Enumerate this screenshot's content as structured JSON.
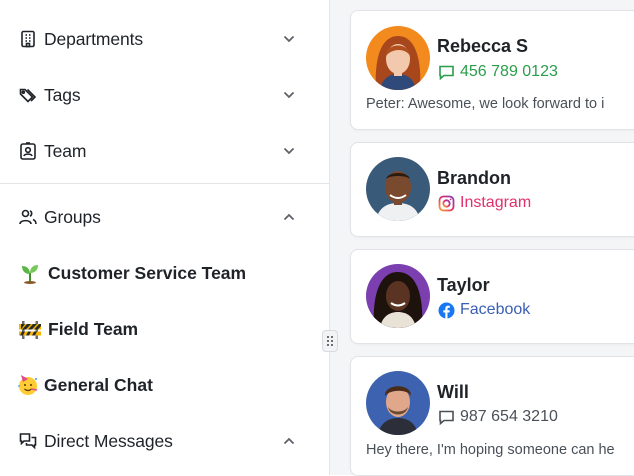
{
  "sidebar": {
    "sections": [
      {
        "label": "Departments",
        "icon": "building-icon",
        "expanded": false
      },
      {
        "label": "Tags",
        "icon": "tags-icon",
        "expanded": false
      },
      {
        "label": "Team",
        "icon": "id-badge-icon",
        "expanded": false
      }
    ],
    "groups_header": {
      "label": "Groups",
      "icon": "users-icon",
      "expanded": true
    },
    "groups": [
      {
        "label": "Customer Service Team",
        "icon": "seedling-icon"
      },
      {
        "label": "Field Team",
        "icon": "construction-barrier-icon"
      },
      {
        "label": "General Chat",
        "icon": "party-face-icon"
      }
    ],
    "direct_messages_header": {
      "label": "Direct Messages",
      "icon": "chat-bubbles-icon",
      "expanded": true
    }
  },
  "conversations": [
    {
      "name": "Rebecca S",
      "channel_icon": "sms-icon",
      "channel_text": "456 789 0123",
      "channel_color": "#2a9d4b",
      "preview": "Peter: Awesome, we look forward to i"
    },
    {
      "name": "Brandon",
      "channel_icon": "instagram-icon",
      "channel_text": "Instagram",
      "channel_color": "#e1306c"
    },
    {
      "name": "Taylor",
      "channel_icon": "facebook-icon",
      "channel_text": "Facebook",
      "channel_color": "#3a5fb5"
    },
    {
      "name": "Will",
      "channel_icon": "sms-icon",
      "channel_text": "987 654 3210",
      "channel_color": "#4a5058",
      "preview": "Hey there, I'm hoping someone can he"
    }
  ]
}
